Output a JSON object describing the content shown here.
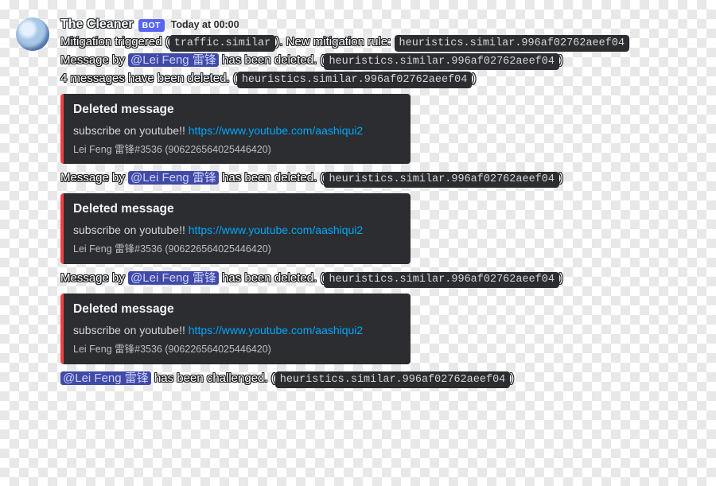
{
  "author": "The Cleaner",
  "bot_tag": "BOT",
  "timestamp": "Today at 00:00",
  "mention": "@Lei Feng 雷锋",
  "rule_trigger": "traffic.similar",
  "rule_name": "heuristics.similar.996af02762aeef04",
  "line1_a": "Mitigation triggered (",
  "line1_b": "). New mitigation rule:",
  "line2_a": "Message by ",
  "line2_b": " has been deleted. (",
  "line3_a": "4 messages have been deleted. (",
  "close_paren": ")",
  "line_chal_a": " has been challenged. (",
  "embed": {
    "title": "Deleted message",
    "body_text": "subscribe on youtube!! ",
    "body_link": "https://www.youtube.com/aashiqui2",
    "footer": "Lei Feng 雷锋#3536 (906226564025446420)"
  }
}
